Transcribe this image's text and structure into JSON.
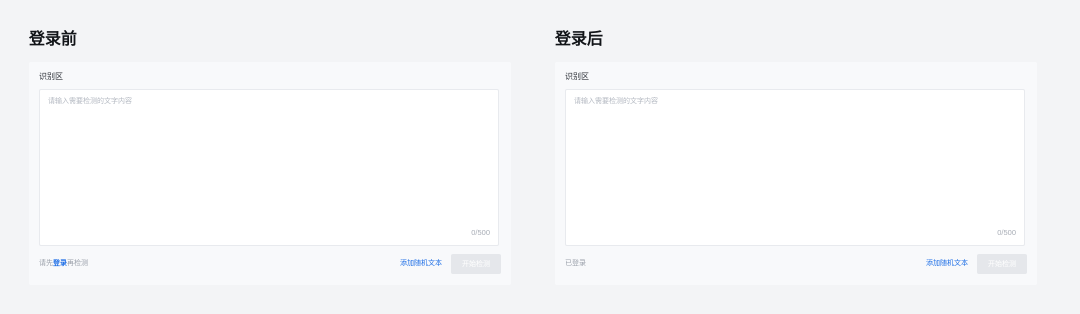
{
  "before": {
    "title": "登录前",
    "area_label": "识别区",
    "placeholder": "请输入需要检测的文字内容",
    "counter": "0/500",
    "status_prefix": "请先",
    "status_link": "登录",
    "status_suffix": "再检测",
    "random_label": "添加随机文本",
    "start_label": "开始检测"
  },
  "after": {
    "title": "登录后",
    "area_label": "识别区",
    "placeholder": "请输入需要检测的文字内容",
    "counter": "0/500",
    "status": "已登录",
    "random_label": "添加随机文本",
    "start_label": "开始检测"
  },
  "colors": {
    "page_background": "#f3f4f6",
    "link_blue": "#1f6fe6",
    "disabled_button": "#e5e7eb"
  }
}
